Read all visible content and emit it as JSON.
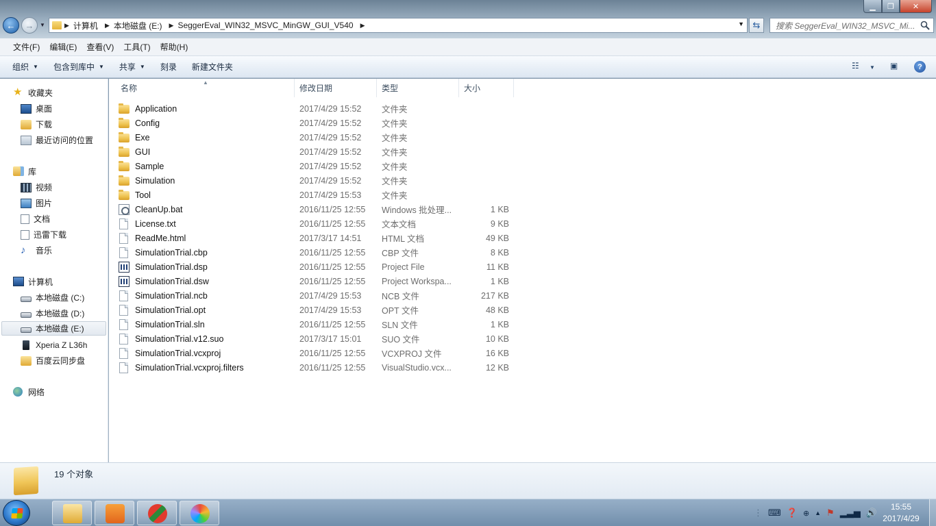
{
  "window": {
    "min_icon": "minimize-icon",
    "max_icon": "maximize-icon",
    "close_glyph": "✕"
  },
  "address": {
    "crumbs": [
      "计算机",
      "本地磁盘 (E:)",
      "SeggerEval_WIN32_MSVC_MinGW_GUI_V540"
    ],
    "search_placeholder": "搜索 SeggerEval_WIN32_MSVC_Mi..."
  },
  "menu": [
    "文件(F)",
    "编辑(E)",
    "查看(V)",
    "工具(T)",
    "帮助(H)"
  ],
  "toolbar": {
    "organize": "组织",
    "include_library": "包含到库中",
    "share": "共享",
    "burn": "刻录",
    "new_folder": "新建文件夹"
  },
  "nav": {
    "favorites": {
      "label": "收藏夹",
      "items": [
        "桌面",
        "下载",
        "最近访问的位置"
      ]
    },
    "libraries": {
      "label": "库",
      "items": [
        "视频",
        "图片",
        "文档",
        "迅雷下载",
        "音乐"
      ]
    },
    "computer": {
      "label": "计算机",
      "items": [
        "本地磁盘 (C:)",
        "本地磁盘 (D:)",
        "本地磁盘 (E:)",
        "Xperia Z L36h",
        "百度云同步盘"
      ]
    },
    "network": {
      "label": "网络"
    }
  },
  "columns": {
    "name": "名称",
    "date": "修改日期",
    "type": "类型",
    "size": "大小"
  },
  "files": [
    {
      "name": "Application",
      "date": "2017/4/29 15:52",
      "type": "文件夹",
      "size": "",
      "icon": "folder"
    },
    {
      "name": "Config",
      "date": "2017/4/29 15:52",
      "type": "文件夹",
      "size": "",
      "icon": "folder"
    },
    {
      "name": "Exe",
      "date": "2017/4/29 15:52",
      "type": "文件夹",
      "size": "",
      "icon": "folder"
    },
    {
      "name": "GUI",
      "date": "2017/4/29 15:52",
      "type": "文件夹",
      "size": "",
      "icon": "folder"
    },
    {
      "name": "Sample",
      "date": "2017/4/29 15:52",
      "type": "文件夹",
      "size": "",
      "icon": "folder"
    },
    {
      "name": "Simulation",
      "date": "2017/4/29 15:52",
      "type": "文件夹",
      "size": "",
      "icon": "folder"
    },
    {
      "name": "Tool",
      "date": "2017/4/29 15:53",
      "type": "文件夹",
      "size": "",
      "icon": "folder"
    },
    {
      "name": "CleanUp.bat",
      "date": "2016/11/25 12:55",
      "type": "Windows 批处理...",
      "size": "1 KB",
      "icon": "bat"
    },
    {
      "name": "License.txt",
      "date": "2016/11/25 12:55",
      "type": "文本文档",
      "size": "9 KB",
      "icon": "doc"
    },
    {
      "name": "ReadMe.html",
      "date": "2017/3/17 14:51",
      "type": "HTML 文档",
      "size": "49 KB",
      "icon": "doc"
    },
    {
      "name": "SimulationTrial.cbp",
      "date": "2016/11/25 12:55",
      "type": "CBP 文件",
      "size": "8 KB",
      "icon": "doc"
    },
    {
      "name": "SimulationTrial.dsp",
      "date": "2016/11/25 12:55",
      "type": "Project File",
      "size": "11 KB",
      "icon": "vs"
    },
    {
      "name": "SimulationTrial.dsw",
      "date": "2016/11/25 12:55",
      "type": "Project Workspa...",
      "size": "1 KB",
      "icon": "vs"
    },
    {
      "name": "SimulationTrial.ncb",
      "date": "2017/4/29 15:53",
      "type": "NCB 文件",
      "size": "217 KB",
      "icon": "doc"
    },
    {
      "name": "SimulationTrial.opt",
      "date": "2017/4/29 15:53",
      "type": "OPT 文件",
      "size": "48 KB",
      "icon": "doc"
    },
    {
      "name": "SimulationTrial.sln",
      "date": "2016/11/25 12:55",
      "type": "SLN 文件",
      "size": "1 KB",
      "icon": "doc"
    },
    {
      "name": "SimulationTrial.v12.suo",
      "date": "2017/3/17 15:01",
      "type": "SUO 文件",
      "size": "10 KB",
      "icon": "doc"
    },
    {
      "name": "SimulationTrial.vcxproj",
      "date": "2016/11/25 12:55",
      "type": "VCXPROJ 文件",
      "size": "16 KB",
      "icon": "doc"
    },
    {
      "name": "SimulationTrial.vcxproj.filters",
      "date": "2016/11/25 12:55",
      "type": "VisualStudio.vcx...",
      "size": "12 KB",
      "icon": "doc"
    }
  ],
  "status": {
    "count": "19 个对象"
  },
  "taskbar": {
    "apps": [
      "explorer-app",
      "foxit-pdf-app",
      "segger-app",
      "picture-viewer-app"
    ],
    "clock_time": "15:55",
    "clock_date": "2017/4/29"
  }
}
